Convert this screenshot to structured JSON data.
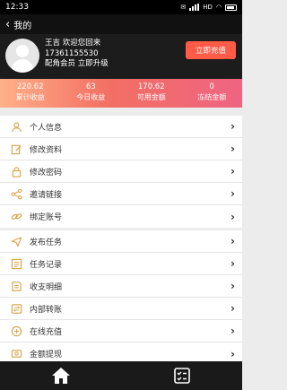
{
  "status": {
    "time": "12:33",
    "icons": [
      "notification-icon",
      "signal-icon",
      "hd-icon",
      "wifi-icon",
      "battery-icon"
    ],
    "hd": "HD"
  },
  "nav": {
    "title": "我的",
    "back_icon": "back-arrow-icon"
  },
  "profile": {
    "line1": "王吉 欢迎您回来",
    "phone": "17361155530",
    "member": "配角会员 立即升级",
    "recharge": "立即充值",
    "avatar": "avatar-placeholder"
  },
  "stats": [
    {
      "value": "220.62",
      "label": "累计收益"
    },
    {
      "value": "63",
      "label": "今日收益"
    },
    {
      "value": "170.62",
      "label": "可用金额"
    },
    {
      "value": "0",
      "label": "冻结金额"
    }
  ],
  "menu_group_1": [
    {
      "label": "个人信息",
      "icon": "user-icon"
    },
    {
      "label": "修改资料",
      "icon": "edit-icon"
    },
    {
      "label": "修改密码",
      "icon": "lock-icon"
    },
    {
      "label": "邀请链接",
      "icon": "share-icon"
    },
    {
      "label": "绑定账号",
      "icon": "link-icon"
    }
  ],
  "menu_group_2": [
    {
      "label": "发布任务",
      "icon": "send-icon"
    },
    {
      "label": "任务记录",
      "icon": "list-icon"
    },
    {
      "label": "收支明细",
      "icon": "book-icon"
    },
    {
      "label": "内部转账",
      "icon": "transfer-icon"
    },
    {
      "label": "在线充值",
      "icon": "recharge-icon"
    },
    {
      "label": "金额提现",
      "icon": "withdraw-icon"
    }
  ],
  "tabbar": [
    {
      "icon": "home-icon"
    },
    {
      "icon": "task-list-icon"
    }
  ],
  "colors": {
    "accent": "#ff5b47",
    "icon": "#d9a245",
    "dark": "#1c1c1c"
  }
}
